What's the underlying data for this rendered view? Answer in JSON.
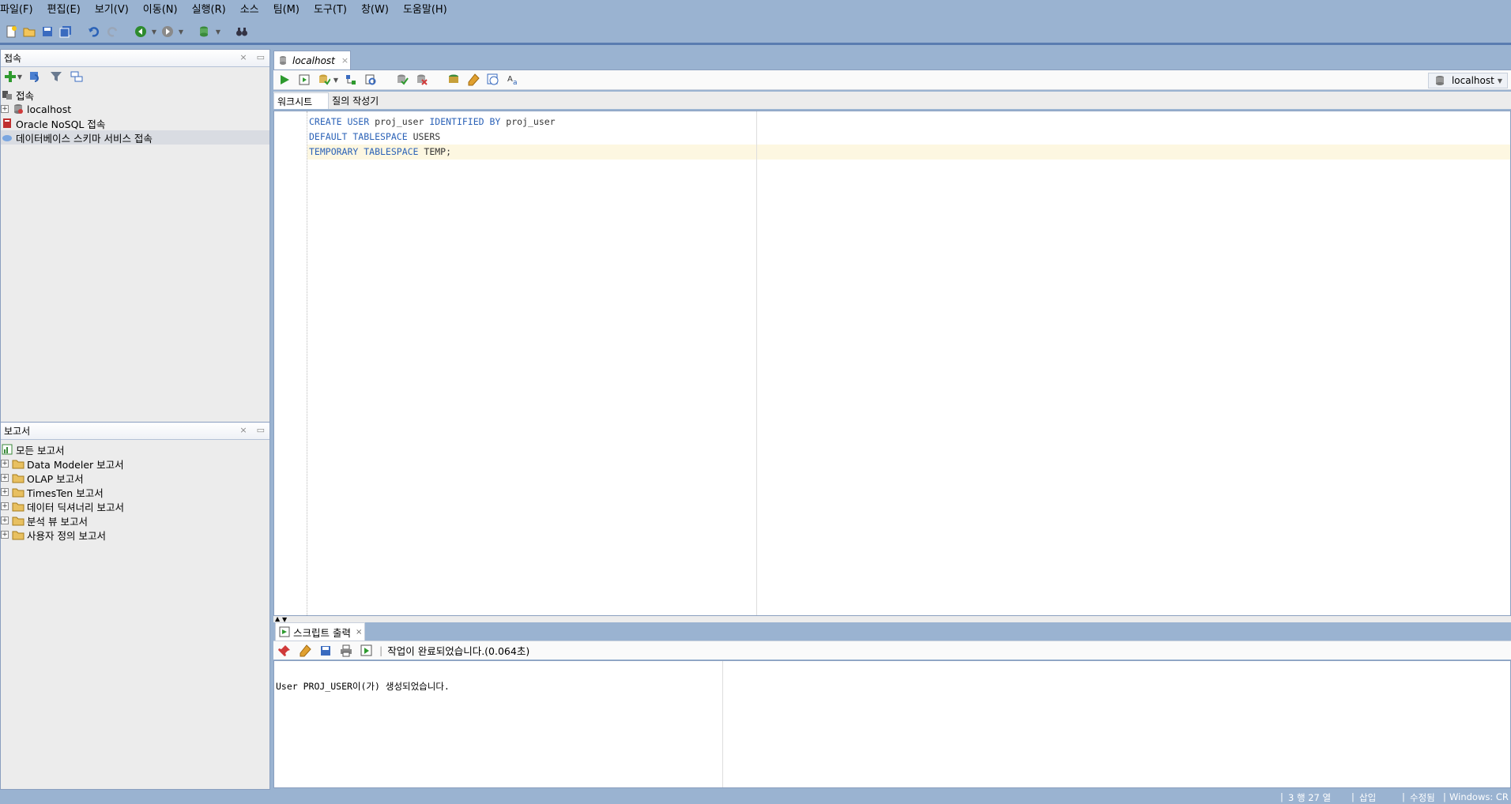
{
  "menu": [
    "파일(F)",
    "편집(E)",
    "보기(V)",
    "이동(N)",
    "실행(R)",
    "소스",
    "팀(M)",
    "도구(T)",
    "창(W)",
    "도움말(H)"
  ],
  "connections_panel": {
    "title": "접속",
    "tree": [
      {
        "label": "접속",
        "expander": false,
        "icon": "connections-icon",
        "indent": 0
      },
      {
        "label": "localhost",
        "expander": true,
        "icon": "database-icon",
        "indent": 0
      },
      {
        "label": "Oracle NoSQL 접속",
        "expander": false,
        "icon": "nosql-icon",
        "indent": 0
      },
      {
        "label": "데이터베이스 스키마 서비스 접속",
        "expander": false,
        "icon": "cloud-icon",
        "indent": 0,
        "selected": true
      }
    ]
  },
  "reports_panel": {
    "title": "보고서",
    "tree": [
      {
        "label": "모든 보고서",
        "expander": false,
        "icon": "reports-icon"
      },
      {
        "label": "Data Modeler 보고서",
        "expander": true,
        "icon": "folder-icon"
      },
      {
        "label": "OLAP 보고서",
        "expander": true,
        "icon": "folder-icon"
      },
      {
        "label": "TimesTen 보고서",
        "expander": true,
        "icon": "folder-icon"
      },
      {
        "label": "데이터 딕셔너리 보고서",
        "expander": true,
        "icon": "folder-icon"
      },
      {
        "label": "분석 뷰 보고서",
        "expander": true,
        "icon": "folder-icon"
      },
      {
        "label": "사용자 정의 보고서",
        "expander": true,
        "icon": "folder-icon"
      }
    ]
  },
  "editor": {
    "tab_label": "localhost",
    "connection": "localhost",
    "subtabs": [
      "워크시트",
      "질의 작성기"
    ],
    "code": [
      [
        {
          "t": "CREATE USER ",
          "kw": true
        },
        {
          "t": "proj_user ",
          "kw": false
        },
        {
          "t": "IDENTIFIED BY ",
          "kw": true
        },
        {
          "t": "proj_user",
          "kw": false
        }
      ],
      [
        {
          "t": "DEFAULT TABLESPACE ",
          "kw": true
        },
        {
          "t": "USERS",
          "kw": false
        }
      ],
      [
        {
          "t": "TEMPORARY TABLESPACE ",
          "kw": true
        },
        {
          "t": "TEMP;",
          "kw": false
        }
      ]
    ]
  },
  "output": {
    "tab_label": "스크립트 출력",
    "status": "작업이 완료되었습니다.(0.064초)",
    "message": "User PROJ_USER이(가) 생성되었습니다."
  },
  "statusbar": {
    "position": "3 행 27 열",
    "mode": "삽입",
    "modified": "수정됨",
    "encoding": "Windows: CR"
  },
  "colors": {
    "keyword": "#2b62b7",
    "chrome": "#9ab3d1"
  }
}
